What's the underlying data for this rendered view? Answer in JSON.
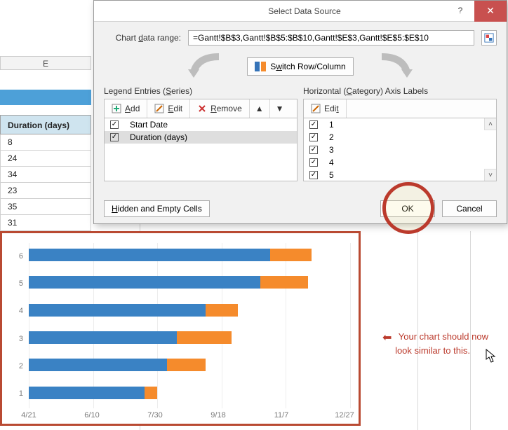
{
  "dialog": {
    "title": "Select Data Source",
    "range_label": "Chart data range:",
    "range_value": "=Gantt!$B$3,Gantt!$B$5:$B$10,Gantt!$E$3,Gantt!$E$5:$E$10",
    "switch_label": "Switch Row/Column",
    "legend_title": "Legend Entries (Series)",
    "legend_toolbar": {
      "add": "Add",
      "edit": "Edit",
      "remove": "Remove"
    },
    "legend_items": [
      {
        "checked": true,
        "label": "Start Date"
      },
      {
        "checked": true,
        "label": "Duration (days)"
      }
    ],
    "axis_title": "Horizontal (Category) Axis Labels",
    "axis_toolbar": {
      "edit": "Edit"
    },
    "axis_items": [
      {
        "checked": true,
        "label": "1"
      },
      {
        "checked": true,
        "label": "2"
      },
      {
        "checked": true,
        "label": "3"
      },
      {
        "checked": true,
        "label": "4"
      },
      {
        "checked": true,
        "label": "5"
      }
    ],
    "hidden_btn": "Hidden and Empty Cells",
    "ok": "OK",
    "cancel": "Cancel",
    "help": "?",
    "close": "✕"
  },
  "sheet": {
    "col_letter": "E",
    "header": "Duration (days)",
    "values": [
      "8",
      "24",
      "34",
      "23",
      "35",
      "31"
    ]
  },
  "chart_data": {
    "type": "bar",
    "orientation": "horizontal",
    "categories": [
      "1",
      "2",
      "3",
      "4",
      "5",
      "6"
    ],
    "series": [
      {
        "name": "Start Date",
        "color": "#3a82c4",
        "role": "offset"
      },
      {
        "name": "Duration (days)",
        "color": "#f58b2c",
        "role": "duration"
      }
    ],
    "x_axis_type": "date",
    "x_ticks": [
      "4/21",
      "6/10",
      "7/30",
      "9/18",
      "11/7",
      "12/27"
    ],
    "note": "Values below are relative widths (0..1 of x-range) as read from the rendered chart, since exact dates are not labeled per-bar.",
    "bars": [
      {
        "category": "1",
        "blue_span": 0.36,
        "orange_span": 0.04
      },
      {
        "category": "2",
        "blue_span": 0.43,
        "orange_span": 0.12
      },
      {
        "category": "3",
        "blue_span": 0.46,
        "orange_span": 0.17
      },
      {
        "category": "4",
        "blue_span": 0.55,
        "orange_span": 0.1
      },
      {
        "category": "5",
        "blue_span": 0.72,
        "orange_span": 0.15
      },
      {
        "category": "6",
        "blue_span": 0.75,
        "orange_span": 0.13
      }
    ]
  },
  "annotation": {
    "text1": "Your chart should now",
    "text2": "look similar to this."
  }
}
